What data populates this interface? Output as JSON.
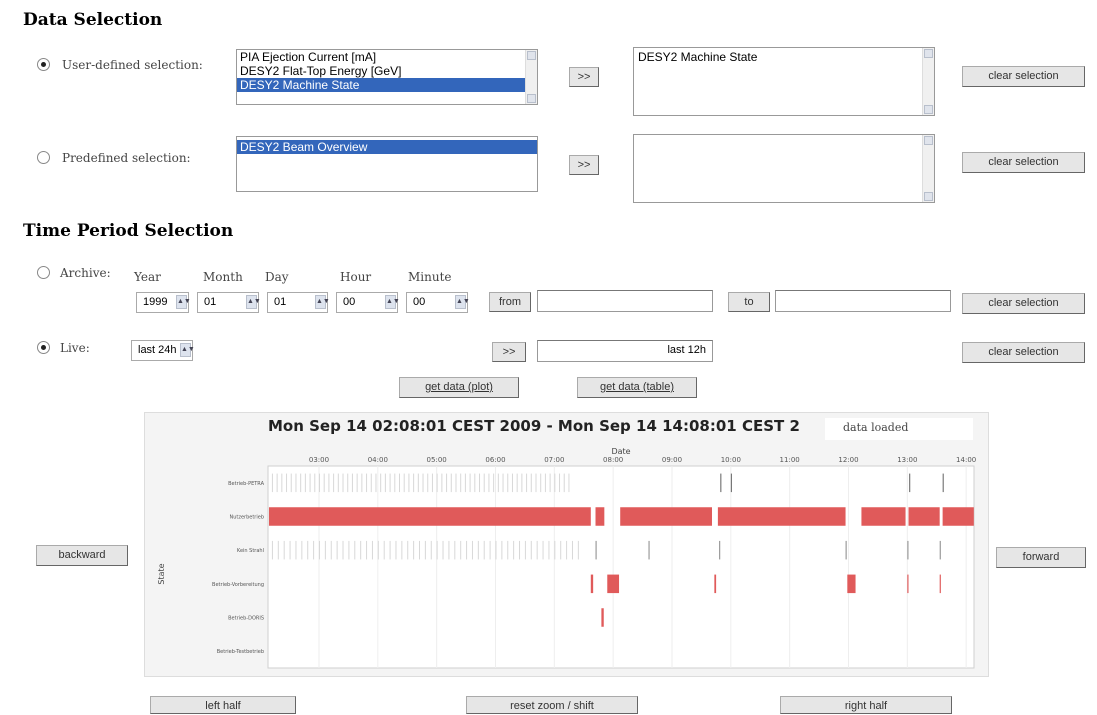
{
  "data_selection": {
    "heading": "Data Selection",
    "user_defined": {
      "label": "User-defined selection:",
      "checked": true,
      "options": [
        "PIA Ejection Current [mA]",
        "DESY2 Flat-Top Energy [GeV]",
        "DESY2 Machine State"
      ],
      "selected_index": 2,
      "add_label": ">>",
      "selected_items": [
        "DESY2 Machine State"
      ],
      "clear_label": "clear selection"
    },
    "predefined": {
      "label": "Predefined selection:",
      "checked": false,
      "options": [
        "DESY2 Beam Overview"
      ],
      "selected_index": 0,
      "add_label": ">>",
      "selected_items": [],
      "clear_label": "clear selection"
    }
  },
  "time_period": {
    "heading": "Time Period Selection",
    "archive": {
      "label": "Archive:",
      "checked": false,
      "field_labels": {
        "year": "Year",
        "month": "Month",
        "day": "Day",
        "hour": "Hour",
        "minute": "Minute"
      },
      "values": {
        "year": "1999",
        "month": "01",
        "day": "01",
        "hour": "00",
        "minute": "00"
      },
      "from_label": "from",
      "from_value": "",
      "to_label": "to",
      "to_value": "",
      "clear_label": "clear selection"
    },
    "live": {
      "label": "Live:",
      "checked": true,
      "range_value": "last 24h",
      "add_label": ">>",
      "range_text": "last 12h",
      "clear_label": "clear selection"
    },
    "get_plot_label": "get data (plot)",
    "get_table_label": "get data (table)"
  },
  "plot": {
    "title": "Mon Sep 14 02:08:01 CEST 2009 - Mon Sep 14 14:08:01 CEST 2",
    "status": "data loaded",
    "x_axis_label": "Date",
    "x_ticks": [
      "03:00",
      "04:00",
      "05:00",
      "06:00",
      "07:00",
      "08:00",
      "09:00",
      "10:00",
      "11:00",
      "12:00",
      "13:00",
      "14:00"
    ],
    "y_axis_label": "State",
    "y_categories": [
      "Betrieb-PETRA",
      "Nutzerbetrieb",
      "Kein Strahl",
      "Betrieb-Vorbereitung",
      "Betrieb-DORIS",
      "Betrieb-Testbetrieb"
    ],
    "bar_color": "#e05a5a",
    "tick_color": "#cccccc",
    "backward_label": "backward",
    "forward_label": "forward",
    "left_half_label": "left half",
    "reset_label": "reset zoom / shift",
    "right_half_label": "right half"
  }
}
